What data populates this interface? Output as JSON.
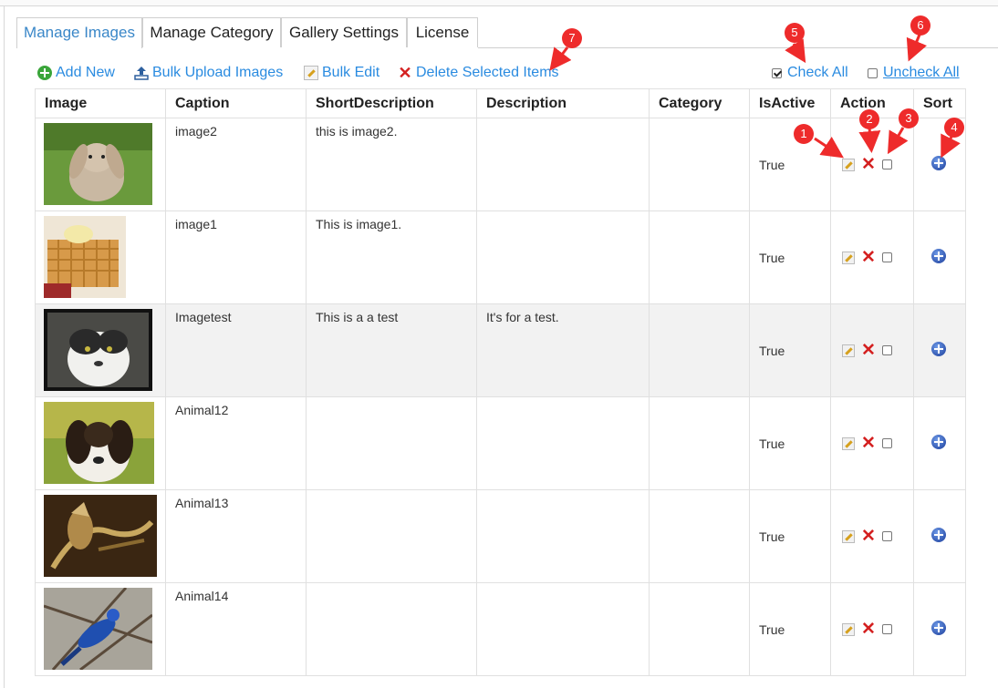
{
  "tabs": [
    {
      "label": "Manage Images",
      "active": true
    },
    {
      "label": "Manage Category"
    },
    {
      "label": "Gallery Settings"
    },
    {
      "label": "License"
    }
  ],
  "toolbar": {
    "add_new": "Add New",
    "bulk_upload": "Bulk Upload Images",
    "bulk_edit": "Bulk Edit",
    "delete_selected": "Delete Selected Items",
    "check_all": "Check All",
    "uncheck_all": "Uncheck All"
  },
  "table": {
    "headers": [
      "Image",
      "Caption",
      "ShortDescription",
      "Description",
      "Category",
      "IsActive",
      "Action",
      "Sort"
    ],
    "rows": [
      {
        "caption": "image2",
        "short": "this is image2.",
        "description": "",
        "category": "",
        "active": "True",
        "thumb": "rabbit"
      },
      {
        "caption": "image1",
        "short": "This is image1.",
        "description": "",
        "category": "",
        "active": "True",
        "thumb": "waffle"
      },
      {
        "caption": "Imagetest",
        "short": "This is a a test",
        "description": "It's for a test.",
        "category": "",
        "active": "True",
        "thumb": "cat"
      },
      {
        "caption": "Animal12",
        "short": "",
        "description": "",
        "category": "",
        "active": "True",
        "thumb": "dog"
      },
      {
        "caption": "Animal13",
        "short": "",
        "description": "",
        "category": "",
        "active": "True",
        "thumb": "horse"
      },
      {
        "caption": "Animal14",
        "short": "",
        "description": "",
        "category": "",
        "active": "True",
        "thumb": "bird"
      }
    ]
  },
  "callouts": [
    "1",
    "2",
    "3",
    "4",
    "5",
    "6",
    "7"
  ],
  "colors": {
    "link": "#2a8be0",
    "active_tab": "#3a87c8",
    "callout": "#ee2b2b",
    "alt_row": "#f2f2f2"
  }
}
